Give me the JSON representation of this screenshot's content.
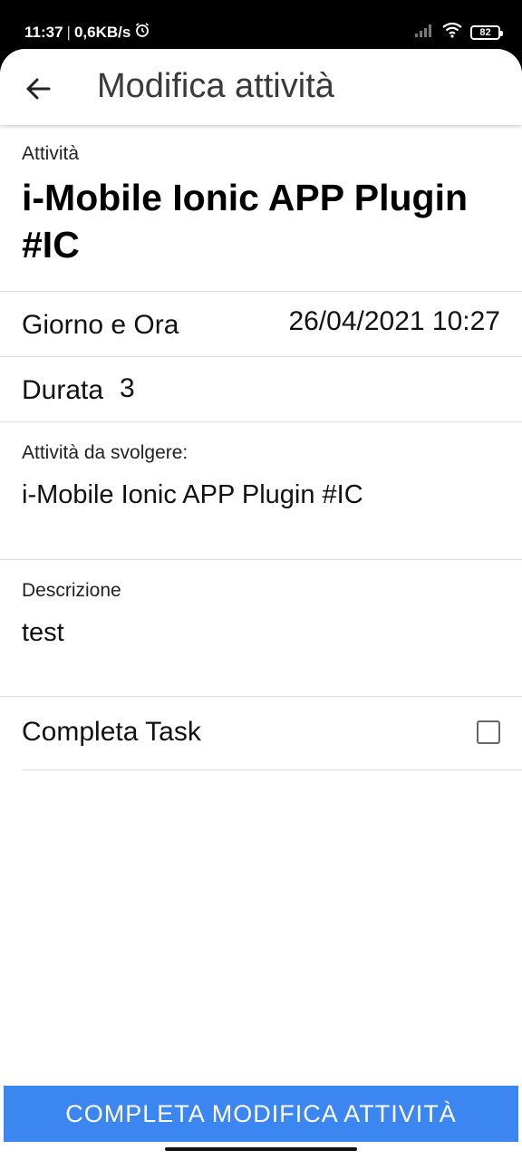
{
  "status_bar": {
    "time": "11:37",
    "separator": "|",
    "net_speed": "0,6KB/s",
    "battery": "82"
  },
  "toolbar": {
    "back_icon": "arrow-back-icon",
    "title": "Modifica attività"
  },
  "activity": {
    "label": "Attività",
    "name": "i-Mobile Ionic APP Plugin #IC"
  },
  "datetime": {
    "label": "Giorno e Ora",
    "value": "26/04/2021 10:27"
  },
  "duration": {
    "label": "Durata",
    "value": "3"
  },
  "todo": {
    "label": "Attività da svolgere:",
    "value": "i-Mobile Ionic APP Plugin #IC"
  },
  "description": {
    "label": "Descrizione",
    "value": "test"
  },
  "complete_task": {
    "label": "Completa Task",
    "checked": false
  },
  "footer": {
    "button_label": "COMPLETA MODIFICA ATTIVITÀ",
    "button_color": "#3b86f0"
  }
}
